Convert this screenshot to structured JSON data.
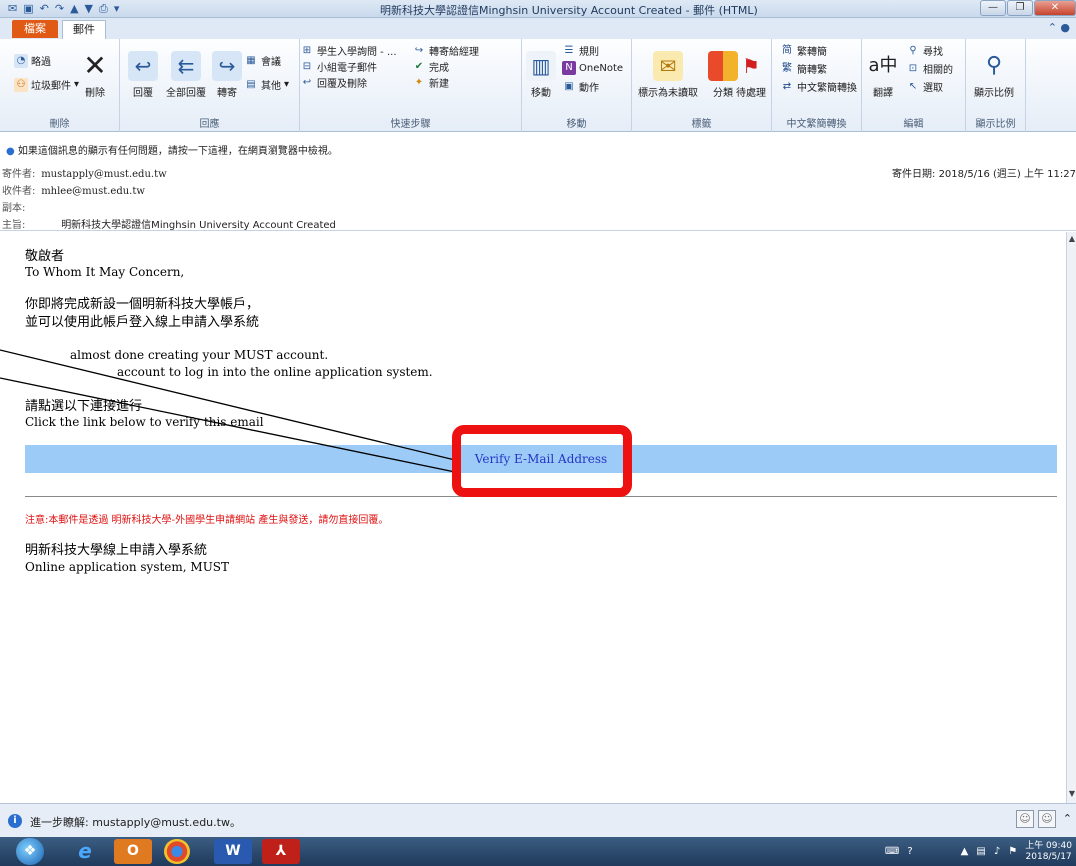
{
  "window": {
    "title": "明新科技大學認證信Minghsin University Account Created - 郵件 (HTML)"
  },
  "ribbon": {
    "tabs": {
      "file": "檔案",
      "mail": "郵件"
    },
    "delete_group": {
      "ignore": "略過",
      "junk": "垃圾郵件",
      "delete": "刪除",
      "label": "刪除"
    },
    "respond_group": {
      "reply": "回覆",
      "reply_all": "全部回覆",
      "forward": "轉寄",
      "meeting": "會議",
      "more": "其他",
      "label": "回應"
    },
    "quick_steps": {
      "step1": "學生入學詢問 - ...",
      "step2": "小組電子郵件",
      "step3": "回覆及刪除",
      "step4": "轉寄給經理",
      "step5": "完成",
      "step6": "新建",
      "label": "快速步驟"
    },
    "move_group": {
      "move": "移動",
      "rules": "規則",
      "onenote": "OneNote",
      "actions": "動作",
      "label": "移動"
    },
    "tags_group": {
      "unread": "標示為未讀取",
      "categorize": "分類",
      "followup": "待處理",
      "label": "標籤"
    },
    "chinese_group": {
      "to_simplified": "繁轉簡",
      "to_traditional": "簡轉繁",
      "convert": "中文繁簡轉換",
      "label": "中文繁簡轉換"
    },
    "editing_group": {
      "translate": "翻譯",
      "find": "尋找",
      "related": "相關的",
      "select": "選取",
      "label": "編輯"
    },
    "zoom_group": {
      "zoom": "顯示比例",
      "label": "顯示比例"
    }
  },
  "message": {
    "info_bar": "如果這個訊息的顯示有任何問題，請按一下這裡，在網頁瀏覽器中檢視。",
    "from_label": "寄件者:",
    "from": "mustapply@must.edu.tw",
    "to_label": "收件者:",
    "to": "mhlee@must.edu.tw",
    "cc_label": "副本:",
    "subject_label": "主旨:",
    "subject": "明新科技大學認證信Minghsin University Account Created",
    "sent_label": "寄件日期:",
    "sent": "2018/5/16 (週三) 上午 11:27"
  },
  "body": {
    "greeting_zh": "敬啟者",
    "greeting_en": "To Whom It May Concern,",
    "line1_zh": "你即將完成新設一個明新科技大學帳戶，",
    "line2_zh": "並可以使用此帳戶登入線上申請入學系統",
    "line1_en": "almost done creating your MUST account.",
    "line2_en": "account to log in into the online application system.",
    "click_zh": "請點選以下連接進行",
    "click_en": "Click the link below to verify this email",
    "verify_link": "Verify E-Mail Address",
    "notice": "注意:本郵件是透過 明新科技大學-外國學生申請網站 產生與發送，請勿直接回覆。",
    "sign_zh": "明新科技大學線上申請入學系統",
    "sign_en": "Online application system, MUST"
  },
  "people_bar": {
    "text": "進一步瞭解: mustapply@must.edu.tw。"
  },
  "taskbar": {
    "time": "上午 09:40",
    "date": "2018/5/17"
  },
  "colors": {
    "verify_band": "#9ccbf8",
    "highlight_box": "#ee1111",
    "notice": "#e01010",
    "link": "#2535c5"
  }
}
